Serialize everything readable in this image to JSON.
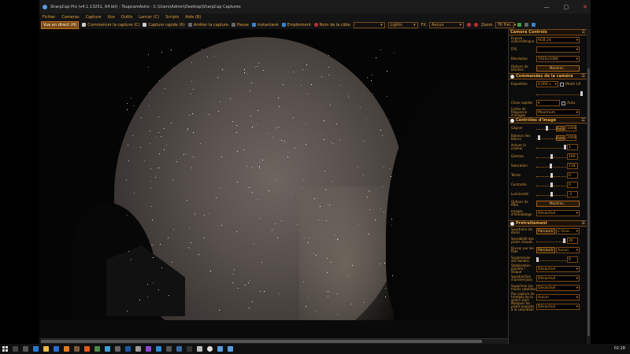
{
  "window": {
    "title": "SharpCap Pro (v4.1.13251, 64 bit) - ToupcamAstro - C:\\Users\\Admin\\Desktop\\SharpCap Captures",
    "minimize": "—",
    "maximize": "▢",
    "close": "✕"
  },
  "menu": [
    "Fichier",
    "Cameras",
    "Capture",
    "Vue",
    "Outils",
    "Lancer (C)",
    "Scripts",
    "Aide (B)"
  ],
  "toolbar": {
    "live": "Vue en direct (H)",
    "start_capture": "Commencer la capture (C)",
    "quick_capture": "Capture rapide (R)",
    "stop_capture": "Arrêter la capture",
    "pause": "Pause",
    "snapshot": "Instantané",
    "stacking": "Empilement",
    "target_name_label": "Nom de la cible",
    "target_name_value": "",
    "filter_value": "Lights",
    "fx_label": "FX",
    "fx_value": "Aucun",
    "zoom_label": "Zoom",
    "zoom_value": "Fit Hei..."
  },
  "panel": {
    "camera_controls": {
      "title": "Camera Controls",
      "rows": [
        {
          "label": "Espace colorimétrique",
          "value": "RGB 24"
        },
        {
          "label": "FPS",
          "value": ""
        },
        {
          "label": "Résolution",
          "value": "1920x1080"
        },
        {
          "label": "Options de broches",
          "button": "Montrer..."
        }
      ]
    },
    "camera_commands": {
      "title": "Commandes de la caméra",
      "exposure_label": "Exposition",
      "exposure_value": "4,000 s",
      "lx_label": "Mode LX",
      "quick_label": "Choix rapides",
      "auto_label": "Auto",
      "limit_label": "Limite de fréquence d'images",
      "limit_value": "Maximum"
    },
    "image_controls": {
      "title": "Contrôles d'image",
      "gain_label": "Gagner",
      "gain_auto": "Auto",
      "gain_value": "1000",
      "wb_label": "Balance des blancs",
      "wb_auto": "Auto",
      "wb_value": "2000",
      "color_label": "Activer la couleur",
      "color_value": "1",
      "sliders": [
        {
          "label": "Gamma",
          "value": "100",
          "pos": 0.5
        },
        {
          "label": "Saturation",
          "value": "118",
          "pos": 0.48
        },
        {
          "label": "Teinte",
          "value": "0",
          "pos": 0.5
        },
        {
          "label": "Contraste",
          "value": "0",
          "pos": 0.5
        },
        {
          "label": "Luminosité",
          "value": "-1",
          "pos": 0.5
        }
      ],
      "filter_options_label": "Options de filtre",
      "filter_options_button": "Montrer...",
      "hist_label": "Images d'horodatage",
      "hist_value": "Désactivé"
    },
    "preprocessing": {
      "title": "Prétraitement",
      "subtract_dark_label": "Soustraire les darks",
      "subtract_dark_button": "Parcourir",
      "subtract_dark_value": "C:\\Use...",
      "hot_pixel_label": "Sensibilité des pixels chauds",
      "hot_pixel_value": "26",
      "flat_label": "Diviser par les flats",
      "flat_button": "Parcourir",
      "flat_value": "Aucun",
      "banding_label": "Suppression des bandes",
      "banding_value": "0",
      "planet_label": "Stabilisation planète / disque",
      "planet_value": "Désactivé",
      "bg_label": "Soustraction d'arrière-plan",
      "bg_value": "Désactivé",
      "satellite_label": "Supprimer les traces satellites",
      "satellite_value": "Désactivé",
      "stack_label": "Pas capture de trombes de la watch start",
      "stack_value": "Aucun",
      "mask_label": "Masquer les pixels exposés à la saturation",
      "mask_value": "Désactivé"
    }
  },
  "taskbar": {
    "clock": "02:28"
  }
}
